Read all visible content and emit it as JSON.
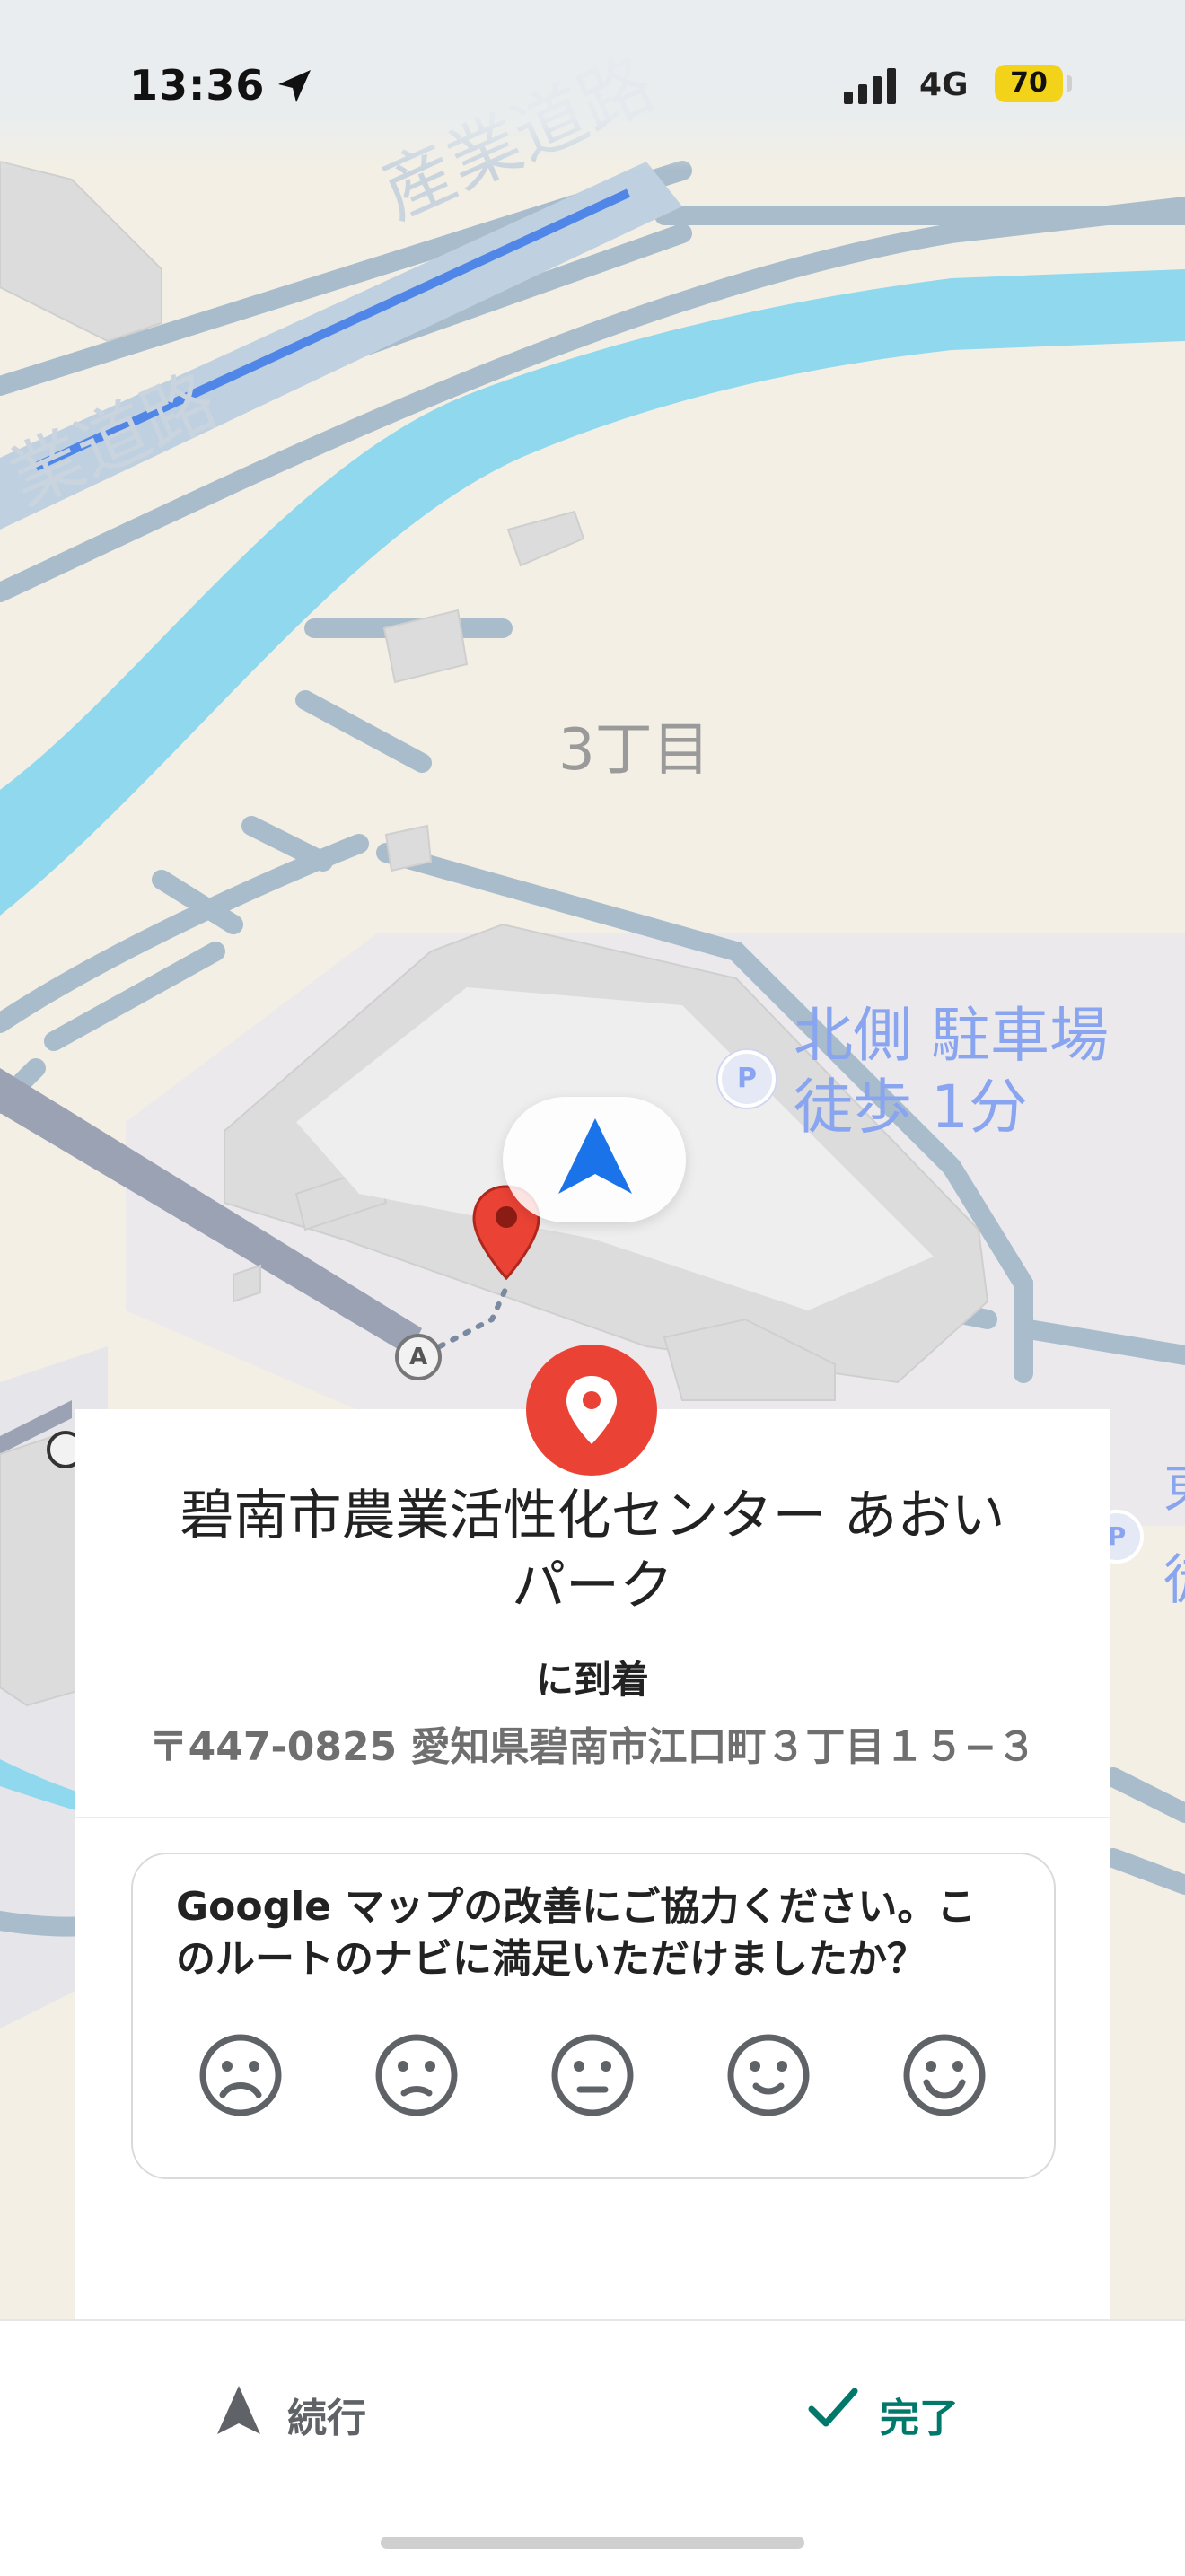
{
  "status_bar": {
    "time": "13:36",
    "network": "4G",
    "battery": "70"
  },
  "map": {
    "road_label_1": "産業道路",
    "road_label_2": "業道路",
    "area_label": "3丁目",
    "parking_name": "北側 駐車場",
    "parking_walk": "徒歩 1分",
    "parking_icon_text": "P",
    "waypoint_label": "A",
    "edge_label_1": "東",
    "edge_label_2": "徒"
  },
  "destination": {
    "name": "碧南市農業活性化センター あおいパーク",
    "name_line1": "碧南市農業活性化センター あおい",
    "name_line2": "パーク",
    "arrival_text": "に到着",
    "address": "〒447-0825 愛知県碧南市江口町３丁目１５−３"
  },
  "feedback": {
    "question": "Google マップの改善にご協力ください。このルートのナビに満足いただけましたか？",
    "ratings": [
      "very-dissatisfied",
      "dissatisfied",
      "neutral",
      "satisfied",
      "very-satisfied"
    ]
  },
  "bottom_bar": {
    "continue_label": "続行",
    "done_label": "完了"
  },
  "colors": {
    "accent_done": "#00796b",
    "pin_red": "#ea4335",
    "nav_arrow": "#1a73e8",
    "water": "#8fd8ee",
    "road": "#a9bccb",
    "parking_text": "#8aa5f0"
  }
}
